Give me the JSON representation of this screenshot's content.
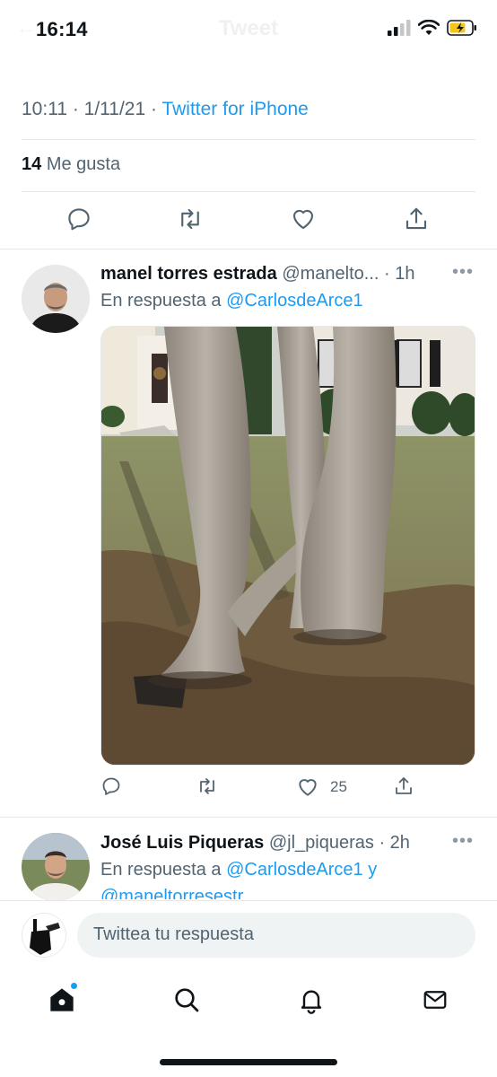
{
  "status": {
    "time": "16:14"
  },
  "header": {
    "title": "Tweet"
  },
  "tweet_detail": {
    "timestamp": "10:11 · 1/11/21 · ",
    "source": "Twitter for iPhone",
    "likes_count": "14",
    "likes_label": "Me gusta"
  },
  "reply1": {
    "name": "manel torres estrada",
    "handle": "@manelto...",
    "time": "· 1h",
    "reply_prefix": "En respuesta a ",
    "reply_to": "@CarlosdeArce1",
    "like_count": "25"
  },
  "reply2": {
    "name": "José Luis Piqueras",
    "handle": "@jl_piqueras · 2h",
    "reply_prefix": "En respuesta a ",
    "reply_to": "@CarlosdeArce1 y",
    "reply_to_2": "@maneltorresestr"
  },
  "composer": {
    "placeholder": "Twittea tu respuesta"
  },
  "icons": {
    "reply": "reply-icon",
    "retweet": "retweet-icon",
    "like": "heart-icon",
    "share": "share-icon",
    "home": "home-icon",
    "search": "search-icon",
    "notifications": "bell-icon",
    "messages": "mail-icon"
  },
  "colors": {
    "link": "#1d9bf0",
    "secondary": "#536471",
    "text": "#0f1419"
  }
}
